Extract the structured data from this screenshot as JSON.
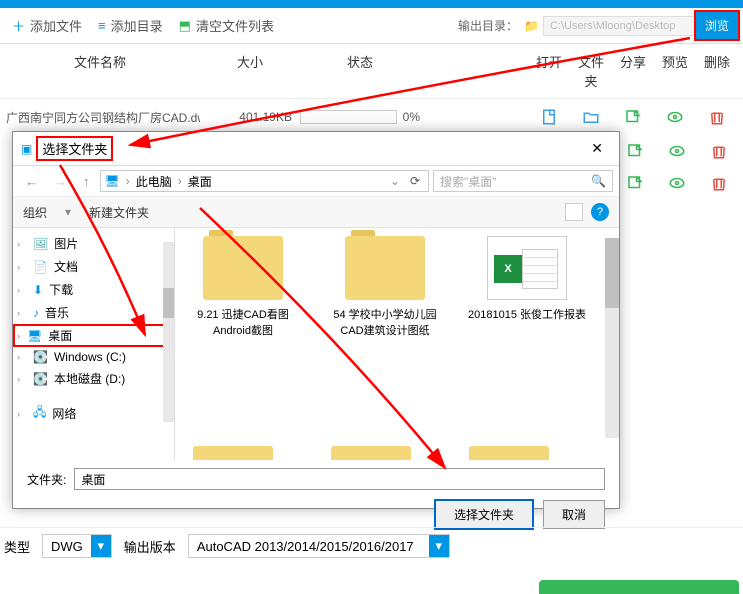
{
  "toolbar": {
    "add_file": "添加文件",
    "add_dir": "添加目录",
    "clear_list": "清空文件列表",
    "output_label": "输出目录：",
    "output_path": "C:\\Users\\Mloong\\Desktop",
    "browse": "浏览"
  },
  "columns": {
    "name": "文件名称",
    "size": "大小",
    "state": "状态",
    "open": "打开",
    "folder": "文件夹",
    "share": "分享",
    "preview": "预览",
    "delete": "删除"
  },
  "rows": [
    {
      "name": "广西南宁同方公司钢结构厂房CAD.dwg",
      "size": "401.19KB",
      "progress": "0%"
    }
  ],
  "dialog": {
    "title": "选择文件夹",
    "breadcrumb": {
      "root": "此电脑",
      "current": "桌面"
    },
    "search_placeholder": "搜索\"桌面\"",
    "organize": "组织",
    "newfolder": "新建文件夹",
    "tree": {
      "pictures": "图片",
      "docs": "文档",
      "downloads": "下载",
      "music": "音乐",
      "desktop": "桌面",
      "winc": "Windows (C:)",
      "locald": "本地磁盘 (D:)",
      "network": "网络"
    },
    "items": [
      {
        "name": "9.21 迅捷CAD看图Android截图",
        "type": "folder"
      },
      {
        "name": "54 学校中小学幼儿园CAD建筑设计图纸",
        "type": "folder"
      },
      {
        "name": "20181015 张俊工作报表",
        "type": "excel"
      }
    ],
    "folder_label": "文件夹:",
    "folder_value": "桌面",
    "select_btn": "选择文件夹",
    "cancel_btn": "取消"
  },
  "bottom": {
    "type_label": "类型",
    "type_value": "DWG",
    "version_label": "输出版本",
    "version_value": "AutoCAD 2013/2014/2015/2016/2017"
  }
}
